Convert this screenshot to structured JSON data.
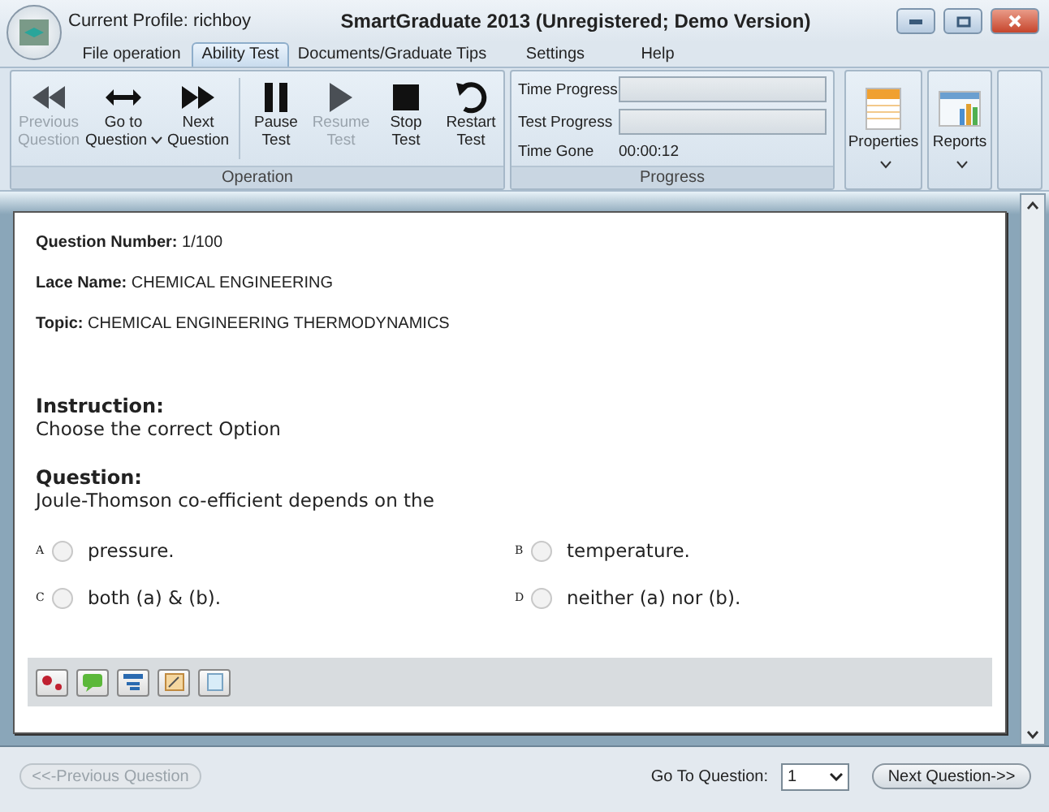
{
  "window": {
    "profile": "Current Profile: richboy",
    "title": "SmartGraduate 2013 (Unregistered; Demo Version)"
  },
  "tabs": [
    {
      "label": "File operation",
      "selected": false
    },
    {
      "label": "Ability Test",
      "selected": true
    },
    {
      "label": "Documents/Graduate Tips",
      "selected": false
    },
    {
      "label": "Settings",
      "selected": false
    },
    {
      "label": "Help",
      "selected": false
    }
  ],
  "ribbon": {
    "operation": {
      "group_label": "Operation",
      "buttons": [
        {
          "label": "Previous Question",
          "disabled": true,
          "dropdown": false
        },
        {
          "label": "Go to Question",
          "disabled": false,
          "dropdown": true
        },
        {
          "label": "Next Question",
          "disabled": false,
          "dropdown": false
        },
        {
          "label": "Pause Test",
          "disabled": false,
          "dropdown": false
        },
        {
          "label": "Resume Test",
          "disabled": true,
          "dropdown": false
        },
        {
          "label": "Stop Test",
          "disabled": false,
          "dropdown": false
        },
        {
          "label": "Restart Test",
          "disabled": false,
          "dropdown": false
        }
      ]
    },
    "progress": {
      "group_label": "Progress",
      "rows": [
        {
          "kind": "bar",
          "label": "Time Progress",
          "level": 0
        },
        {
          "kind": "bar",
          "label": "Test Progress",
          "level": 0
        },
        {
          "kind": "text",
          "label": "Time Gone",
          "value": "00:00:12"
        }
      ]
    },
    "tools": [
      {
        "label": "Properties"
      },
      {
        "label": "Reports"
      }
    ]
  },
  "question": {
    "meta": [
      "**Question Number:** 1/100",
      "**Lace Name:** CHEMICAL ENGINEERING",
      "**Topic:** CHEMICAL ENGINEERING THERMODYNAMICS"
    ],
    "instruction": {
      "heading": "Instruction:",
      "text": "Choose the correct Option"
    },
    "prompt": {
      "heading": "Question:",
      "text": "Joule-Thomson co-efficient depends on the"
    },
    "options": [
      {
        "letter": "A",
        "text": "pressure.",
        "selected": false
      },
      {
        "letter": "B",
        "text": "temperature.",
        "selected": false
      },
      {
        "letter": "C",
        "text": "both (a) & (b).",
        "selected": false
      },
      {
        "letter": "D",
        "text": "neither (a) nor (b).",
        "selected": false
      }
    ]
  },
  "footer": {
    "previous": {
      "label": "<<-Previous Question",
      "disabled": true
    },
    "goto": {
      "label": "Go To Question:",
      "value": "1"
    },
    "next": {
      "label": "Next Question->>",
      "disabled": false
    }
  }
}
